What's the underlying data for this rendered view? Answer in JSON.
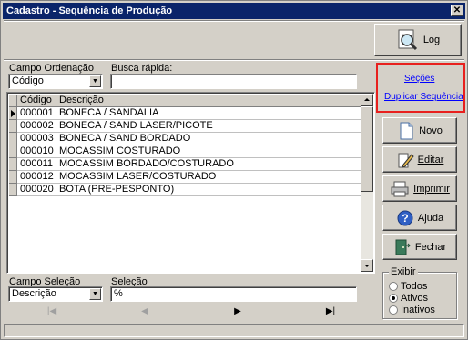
{
  "window": {
    "title": "Cadastro - Sequência de Produção",
    "close_glyph": "✕"
  },
  "toolbar": {
    "log_label": "Log"
  },
  "links": {
    "secoes": "Seções",
    "duplicar": "Duplicar Sequência"
  },
  "filters": {
    "ordenacao_label": "Campo Ordenação",
    "ordenacao_value": "Código",
    "busca_label": "Busca rápida:",
    "busca_value": "",
    "selecao_campo_label": "Campo Seleção",
    "selecao_campo_value": "Descrição",
    "selecao_label": "Seleção",
    "selecao_value": "%"
  },
  "grid": {
    "columns": [
      "Código",
      "Descrição"
    ],
    "rows": [
      {
        "codigo": "000001",
        "descricao": "BONECA / SANDALIA"
      },
      {
        "codigo": "000002",
        "descricao": "BONECA / SAND LASER/PICOTE"
      },
      {
        "codigo": "000003",
        "descricao": "BONECA / SAND BORDADO"
      },
      {
        "codigo": "000010",
        "descricao": "MOCASSIM COSTURADO"
      },
      {
        "codigo": "000011",
        "descricao": "MOCASSIM BORDADO/COSTURADO"
      },
      {
        "codigo": "000012",
        "descricao": "MOCASSIM LASER/COSTURADO"
      },
      {
        "codigo": "000020",
        "descricao": "BOTA (PRE-PESPONTO)"
      }
    ]
  },
  "nav": {
    "first": "|◀",
    "prev": "◀",
    "next": "▶",
    "last": "▶|"
  },
  "actions": {
    "novo": "Novo",
    "editar": "Editar",
    "imprimir": "Imprimir",
    "ajuda": "Ajuda",
    "fechar": "Fechar"
  },
  "exibir": {
    "label": "Exibir",
    "options": [
      "Todos",
      "Ativos",
      "Inativos"
    ],
    "selected": "Ativos"
  },
  "colors": {
    "highlight_border": "#e8201e",
    "link": "#0000ff",
    "titlebar": "#0a246a"
  }
}
